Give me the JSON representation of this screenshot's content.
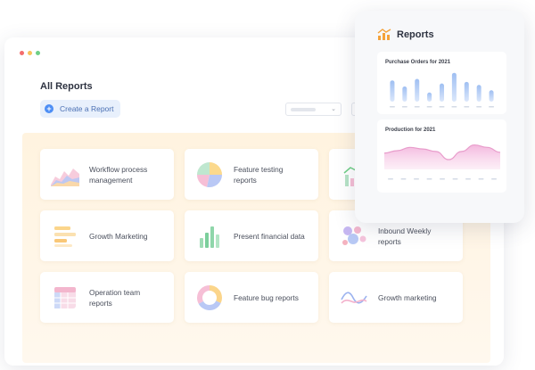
{
  "app": {
    "title": "All Reports",
    "create_label": "Create a Report"
  },
  "cards": [
    {
      "label": "Workflow process management",
      "icon": "area-chart-icon"
    },
    {
      "label": "Feature testing reports",
      "icon": "pie-chart-icon"
    },
    {
      "label": "",
      "icon": "bar-line-chart-icon"
    },
    {
      "label": "Growth Marketing",
      "icon": "horizontal-bar-chart-icon"
    },
    {
      "label": "Present financial data",
      "icon": "bar-chart-icon"
    },
    {
      "label": "Inbound Weekly reports",
      "icon": "bubble-chart-icon"
    },
    {
      "label": "Operation team reports",
      "icon": "table-icon"
    },
    {
      "label": "Feature bug reports",
      "icon": "donut-chart-icon"
    },
    {
      "label": "Growth marketing",
      "icon": "line-chart-icon"
    }
  ],
  "reports_panel": {
    "title": "Reports",
    "charts": [
      {
        "title": "Purchase Orders for 2021"
      },
      {
        "title": "Production for 2021"
      }
    ]
  },
  "chart_data": [
    {
      "type": "bar",
      "title": "Purchase Orders for 2021",
      "categories": [
        "",
        "",
        "",
        "",
        "",
        "",
        "",
        "",
        ""
      ],
      "values": [
        28,
        20,
        30,
        12,
        24,
        38,
        26,
        22,
        15
      ],
      "ylim": [
        0,
        40
      ],
      "color": "#bcd4f6"
    },
    {
      "type": "area",
      "title": "Production for 2021",
      "x": [
        1,
        2,
        3,
        4,
        5,
        6,
        7,
        8,
        9,
        10
      ],
      "values": [
        20,
        23,
        27,
        25,
        22,
        12,
        22,
        30,
        27,
        21
      ],
      "ylim": [
        0,
        35
      ],
      "color": "#f2b8e0"
    }
  ],
  "colors": {
    "accent": "#4d8ef5",
    "panel_bg": "#fff4e2",
    "report_icon": "#f4a23a"
  }
}
